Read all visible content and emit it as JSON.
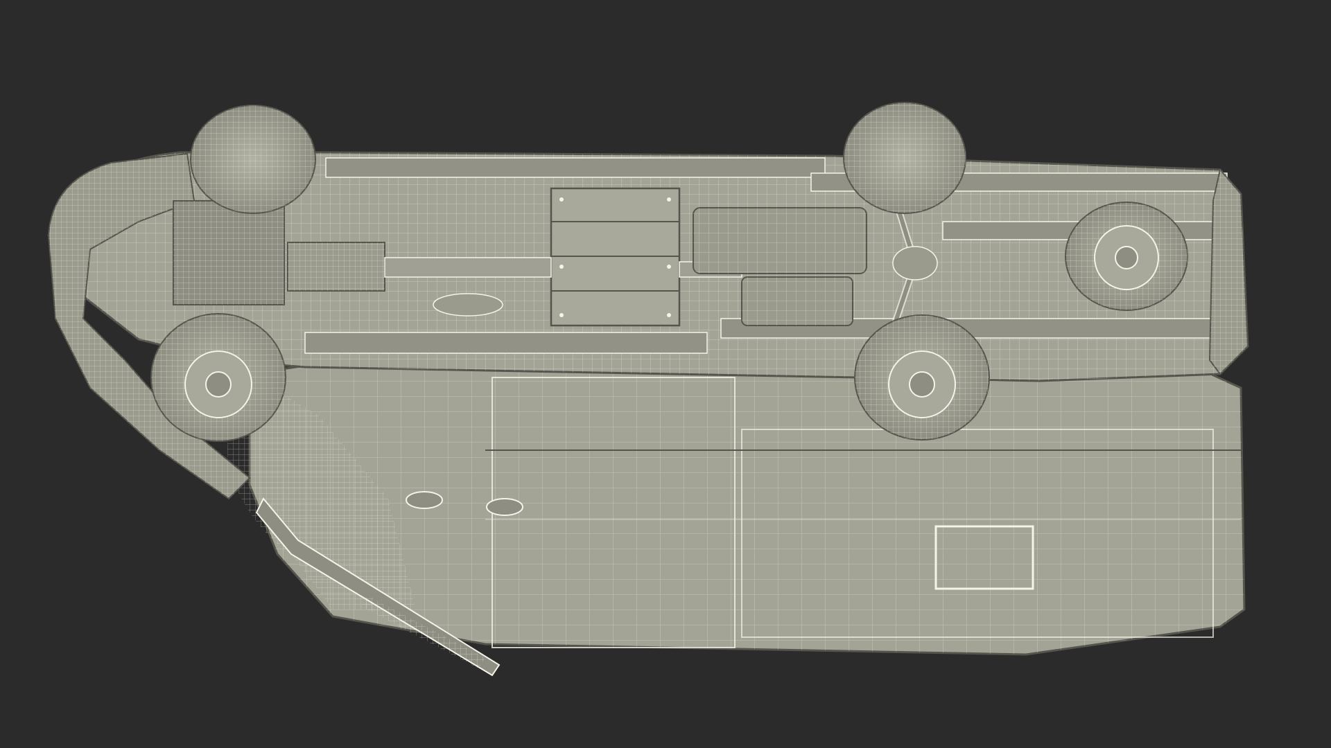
{
  "scene": {
    "subject": "van-underside-wireframe",
    "background_color": "#2b2b2b",
    "body_fill": "#a4a496",
    "body_shade": "#8e8e82",
    "wire_color": "#f4f4ea",
    "dark_line": "#55554d"
  }
}
